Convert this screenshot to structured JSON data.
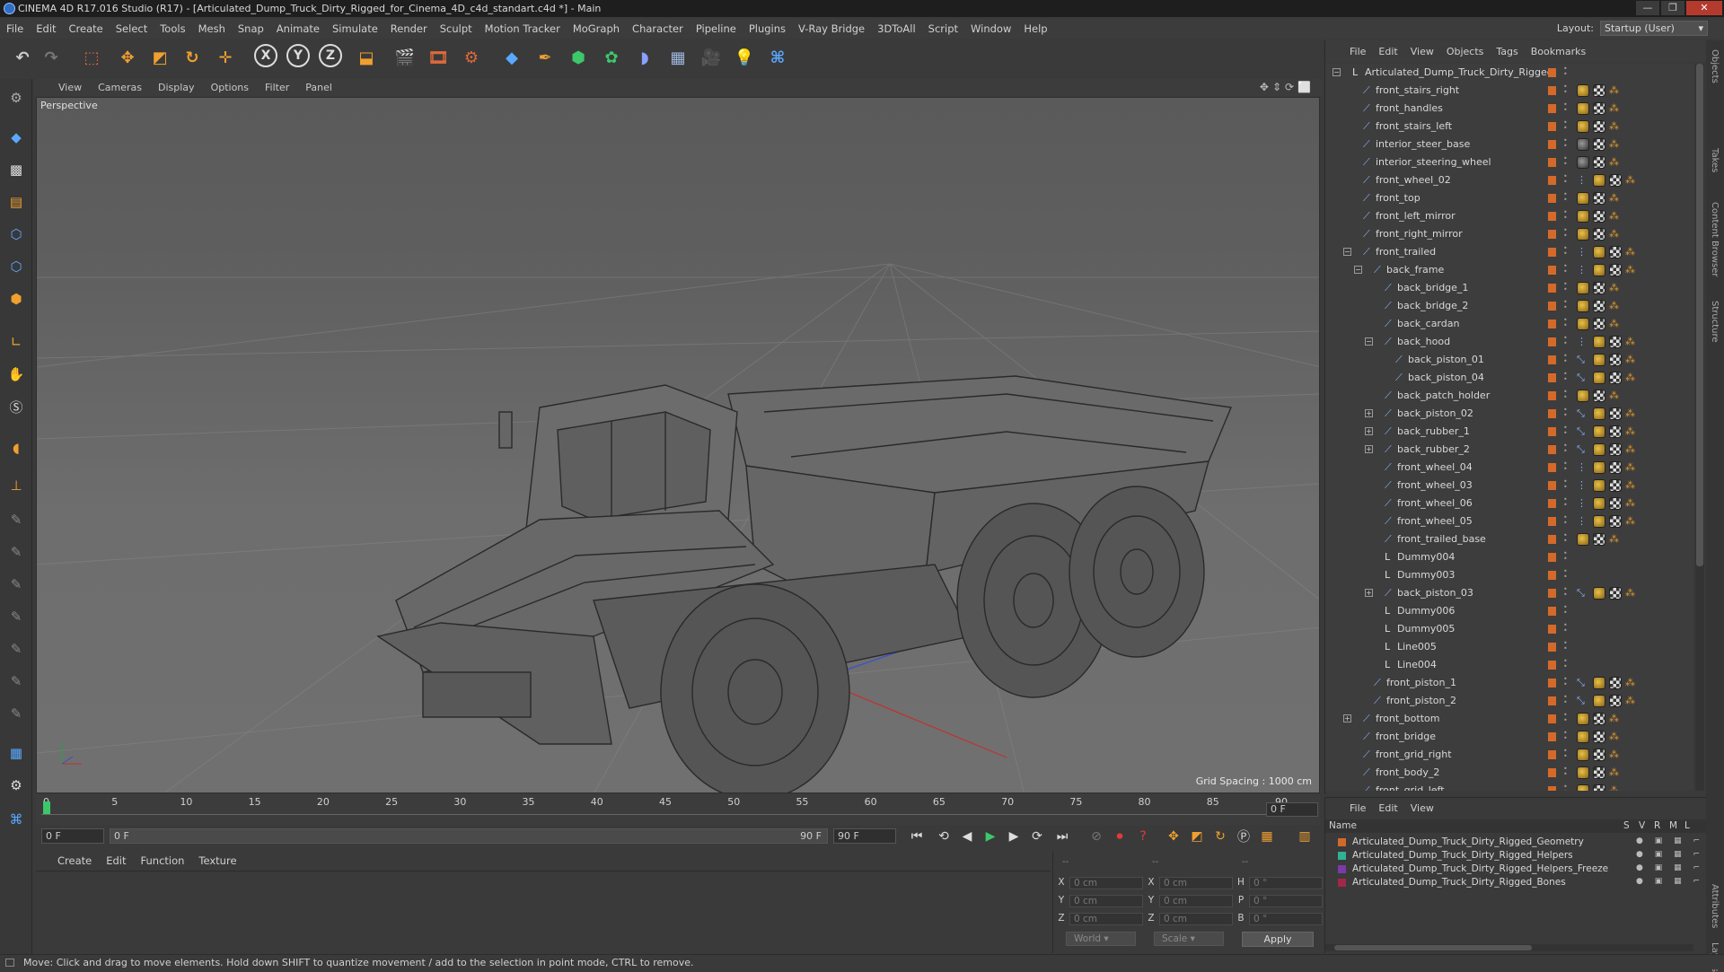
{
  "window": {
    "title": "CINEMA 4D R17.016 Studio (R17) - [Articulated_Dump_Truck_Dirty_Rigged_for_Cinema_4D_c4d_standart.c4d *] - Main",
    "buttons": [
      "—",
      "❐",
      "✕"
    ]
  },
  "menubar": {
    "items": [
      "File",
      "Edit",
      "Create",
      "Select",
      "Tools",
      "Mesh",
      "Snap",
      "Animate",
      "Simulate",
      "Render",
      "Sculpt",
      "Motion Tracker",
      "MoGraph",
      "Character",
      "Pipeline",
      "Plugins",
      "V-Ray Bridge",
      "3DToAll",
      "Script",
      "Window",
      "Help"
    ],
    "layout_label": "Layout:",
    "layout_value": "Startup (User)"
  },
  "toolbar": {
    "icons": [
      "undo-icon",
      "redo-icon",
      "live-selection-icon",
      "move-icon",
      "scale-icon",
      "rotate-icon",
      "transform-icon",
      "x-axis-icon",
      "y-axis-icon",
      "z-axis-icon",
      "coordinate-system-icon",
      "render-view-icon",
      "render-picture-viewer-icon",
      "render-settings-icon",
      "cube-icon",
      "pen-icon",
      "subdivision-icon",
      "cloner-icon",
      "deformer-icon",
      "floor-icon",
      "camera-icon",
      "light-icon",
      "python-icon"
    ],
    "axis_labels": [
      "X",
      "Y",
      "Z"
    ]
  },
  "viewport": {
    "menu": [
      "View",
      "Cameras",
      "Display",
      "Options",
      "Filter",
      "Panel"
    ],
    "label": "Perspective",
    "grid_spacing": "Grid Spacing : 1000 cm",
    "colors": {
      "grid": "#8a8a8a",
      "x_axis": "#c23030",
      "y_axis": "#27a04a",
      "z_axis": "#3a4fcf"
    }
  },
  "timeline": {
    "ticks": [
      "0",
      "5",
      "10",
      "15",
      "20",
      "25",
      "30",
      "35",
      "40",
      "45",
      "50",
      "55",
      "60",
      "65",
      "70",
      "75",
      "80",
      "85",
      "90"
    ],
    "current_frame_box": "0 F",
    "start_field": "0 F",
    "range_start": "0 F",
    "range_end": "90 F",
    "end_field": "90 F"
  },
  "material_manager": {
    "menu": [
      "Create",
      "Edit",
      "Function",
      "Texture"
    ]
  },
  "coordinates": {
    "rows": [
      {
        "a": "X",
        "av": "0 cm",
        "b": "X",
        "bv": "0 cm",
        "c": "H",
        "cv": "0 °"
      },
      {
        "a": "Y",
        "av": "0 cm",
        "b": "Y",
        "bv": "0 cm",
        "c": "P",
        "cv": "0 °"
      },
      {
        "a": "Z",
        "av": "0 cm",
        "b": "Z",
        "bv": "0 cm",
        "c": "B",
        "cv": "0 °"
      }
    ],
    "header": [
      "--",
      "--",
      "--"
    ],
    "mode": "World",
    "transform": "Scale",
    "apply": "Apply"
  },
  "status": "Move: Click and drag to move elements. Hold down SHIFT to quantize movement / add to the selection in point mode, CTRL to remove.",
  "object_manager": {
    "menu": [
      "File",
      "Edit",
      "View",
      "Objects",
      "Tags",
      "Bookmarks"
    ],
    "objects": [
      {
        "name": "Articulated_Dump_Truck_Dirty_Rigged",
        "indent": 0,
        "kind": "null",
        "exp": "−",
        "tags": []
      },
      {
        "name": "front_stairs_right",
        "indent": 1,
        "kind": "bone",
        "tags": [
          "mat",
          "chk",
          "ik"
        ]
      },
      {
        "name": "front_handles",
        "indent": 1,
        "kind": "bone",
        "tags": [
          "mat",
          "chk",
          "ik"
        ]
      },
      {
        "name": "front_stairs_left",
        "indent": 1,
        "kind": "bone",
        "tags": [
          "mat",
          "chk",
          "ik"
        ]
      },
      {
        "name": "interior_steer_base",
        "indent": 1,
        "kind": "bone",
        "tags": [
          "dark",
          "chk",
          "ik"
        ]
      },
      {
        "name": "interior_steering_wheel",
        "indent": 1,
        "kind": "bone",
        "tags": [
          "dark",
          "chk",
          "ik"
        ]
      },
      {
        "name": "front_wheel_02",
        "indent": 1,
        "kind": "bone",
        "tags": [
          "x",
          "mat",
          "chk",
          "ik"
        ]
      },
      {
        "name": "front_top",
        "indent": 1,
        "kind": "bone",
        "tags": [
          "mat",
          "chk",
          "ik"
        ]
      },
      {
        "name": "front_left_mirror",
        "indent": 1,
        "kind": "bone",
        "tags": [
          "mat",
          "chk",
          "ik"
        ]
      },
      {
        "name": "front_right_mirror",
        "indent": 1,
        "kind": "bone",
        "tags": [
          "mat",
          "chk",
          "ik"
        ]
      },
      {
        "name": "front_trailed",
        "indent": 1,
        "kind": "bone",
        "exp": "−",
        "tags": [
          "x",
          "mat",
          "chk",
          "ik"
        ]
      },
      {
        "name": "back_frame",
        "indent": 2,
        "kind": "bone",
        "exp": "−",
        "tags": [
          "x",
          "mat",
          "chk",
          "ik"
        ]
      },
      {
        "name": "back_bridge_1",
        "indent": 3,
        "kind": "bone",
        "tags": [
          "mat",
          "chk",
          "ik"
        ]
      },
      {
        "name": "back_bridge_2",
        "indent": 3,
        "kind": "bone",
        "tags": [
          "mat",
          "chk",
          "ik"
        ]
      },
      {
        "name": "back_cardan",
        "indent": 3,
        "kind": "bone",
        "tags": [
          "mat",
          "chk",
          "ik"
        ]
      },
      {
        "name": "back_hood",
        "indent": 3,
        "kind": "bone",
        "exp": "−",
        "tags": [
          "x",
          "mat",
          "chk",
          "ik"
        ]
      },
      {
        "name": "back_piston_01",
        "indent": 4,
        "kind": "bone",
        "tags": [
          "y",
          "mat",
          "chk",
          "ik"
        ]
      },
      {
        "name": "back_piston_04",
        "indent": 4,
        "kind": "bone",
        "tags": [
          "y",
          "mat",
          "chk",
          "ik"
        ]
      },
      {
        "name": "back_patch_holder",
        "indent": 3,
        "kind": "bone",
        "tags": [
          "mat",
          "chk",
          "ik"
        ]
      },
      {
        "name": "back_piston_02",
        "indent": 3,
        "kind": "bone",
        "exp": "+",
        "tags": [
          "y",
          "mat",
          "chk",
          "ik"
        ]
      },
      {
        "name": "back_rubber_1",
        "indent": 3,
        "kind": "bone",
        "exp": "+",
        "tags": [
          "y",
          "mat",
          "chk",
          "ik"
        ]
      },
      {
        "name": "back_rubber_2",
        "indent": 3,
        "kind": "bone",
        "exp": "+",
        "tags": [
          "y",
          "mat",
          "chk",
          "ik"
        ]
      },
      {
        "name": "front_wheel_04",
        "indent": 3,
        "kind": "bone",
        "tags": [
          "x",
          "mat",
          "chk",
          "ik"
        ]
      },
      {
        "name": "front_wheel_03",
        "indent": 3,
        "kind": "bone",
        "tags": [
          "x",
          "mat",
          "chk",
          "ik"
        ]
      },
      {
        "name": "front_wheel_06",
        "indent": 3,
        "kind": "bone",
        "tags": [
          "x",
          "mat",
          "chk",
          "ik"
        ]
      },
      {
        "name": "front_wheel_05",
        "indent": 3,
        "kind": "bone",
        "tags": [
          "x",
          "mat",
          "chk",
          "ik"
        ]
      },
      {
        "name": "front_trailed_base",
        "indent": 3,
        "kind": "bone",
        "tags": [
          "mat",
          "chk",
          "ik"
        ]
      },
      {
        "name": "Dummy004",
        "indent": 3,
        "kind": "null",
        "tags": []
      },
      {
        "name": "Dummy003",
        "indent": 3,
        "kind": "null",
        "tags": []
      },
      {
        "name": "back_piston_03",
        "indent": 3,
        "kind": "bone",
        "exp": "+",
        "tags": [
          "y",
          "mat",
          "chk",
          "ik"
        ]
      },
      {
        "name": "Dummy006",
        "indent": 3,
        "kind": "null",
        "tags": []
      },
      {
        "name": "Dummy005",
        "indent": 3,
        "kind": "null",
        "tags": []
      },
      {
        "name": "Line005",
        "indent": 3,
        "kind": "null",
        "tags": []
      },
      {
        "name": "Line004",
        "indent": 3,
        "kind": "null",
        "tags": []
      },
      {
        "name": "front_piston_1",
        "indent": 2,
        "kind": "bone",
        "tags": [
          "y",
          "mat",
          "chk",
          "ik"
        ]
      },
      {
        "name": "front_piston_2",
        "indent": 2,
        "kind": "bone",
        "tags": [
          "y",
          "mat",
          "chk",
          "ik"
        ]
      },
      {
        "name": "front_bottom",
        "indent": 1,
        "kind": "bone",
        "exp": "+",
        "tags": [
          "mat",
          "chk",
          "ik"
        ]
      },
      {
        "name": "front_bridge",
        "indent": 1,
        "kind": "bone",
        "tags": [
          "mat",
          "chk",
          "ik"
        ]
      },
      {
        "name": "front_grid_right",
        "indent": 1,
        "kind": "bone",
        "tags": [
          "mat",
          "chk",
          "ik"
        ]
      },
      {
        "name": "front_body_2",
        "indent": 1,
        "kind": "bone",
        "tags": [
          "mat",
          "chk",
          "ik"
        ]
      },
      {
        "name": "front_grid_left",
        "indent": 1,
        "kind": "bone",
        "tags": [
          "mat",
          "chk",
          "ik"
        ]
      }
    ]
  },
  "layer_manager": {
    "menu": [
      "File",
      "Edit",
      "View"
    ],
    "columns": [
      "Name",
      "S",
      "V",
      "R",
      "M",
      "L"
    ],
    "layers": [
      {
        "name": "Articulated_Dump_Truck_Dirty_Rigged_Geometry",
        "color": "#d2692c"
      },
      {
        "name": "Articulated_Dump_Truck_Dirty_Rigged_Helpers",
        "color": "#2fb394"
      },
      {
        "name": "Articulated_Dump_Truck_Dirty_Rigged_Helpers_Freeze",
        "color": "#7b3aa8"
      },
      {
        "name": "Articulated_Dump_Truck_Dirty_Rigged_Bones",
        "color": "#a0284a"
      }
    ]
  },
  "side_tabs": [
    "Objects",
    "Takes",
    "Content Browser",
    "Structure",
    "Attributes",
    "Layers"
  ]
}
